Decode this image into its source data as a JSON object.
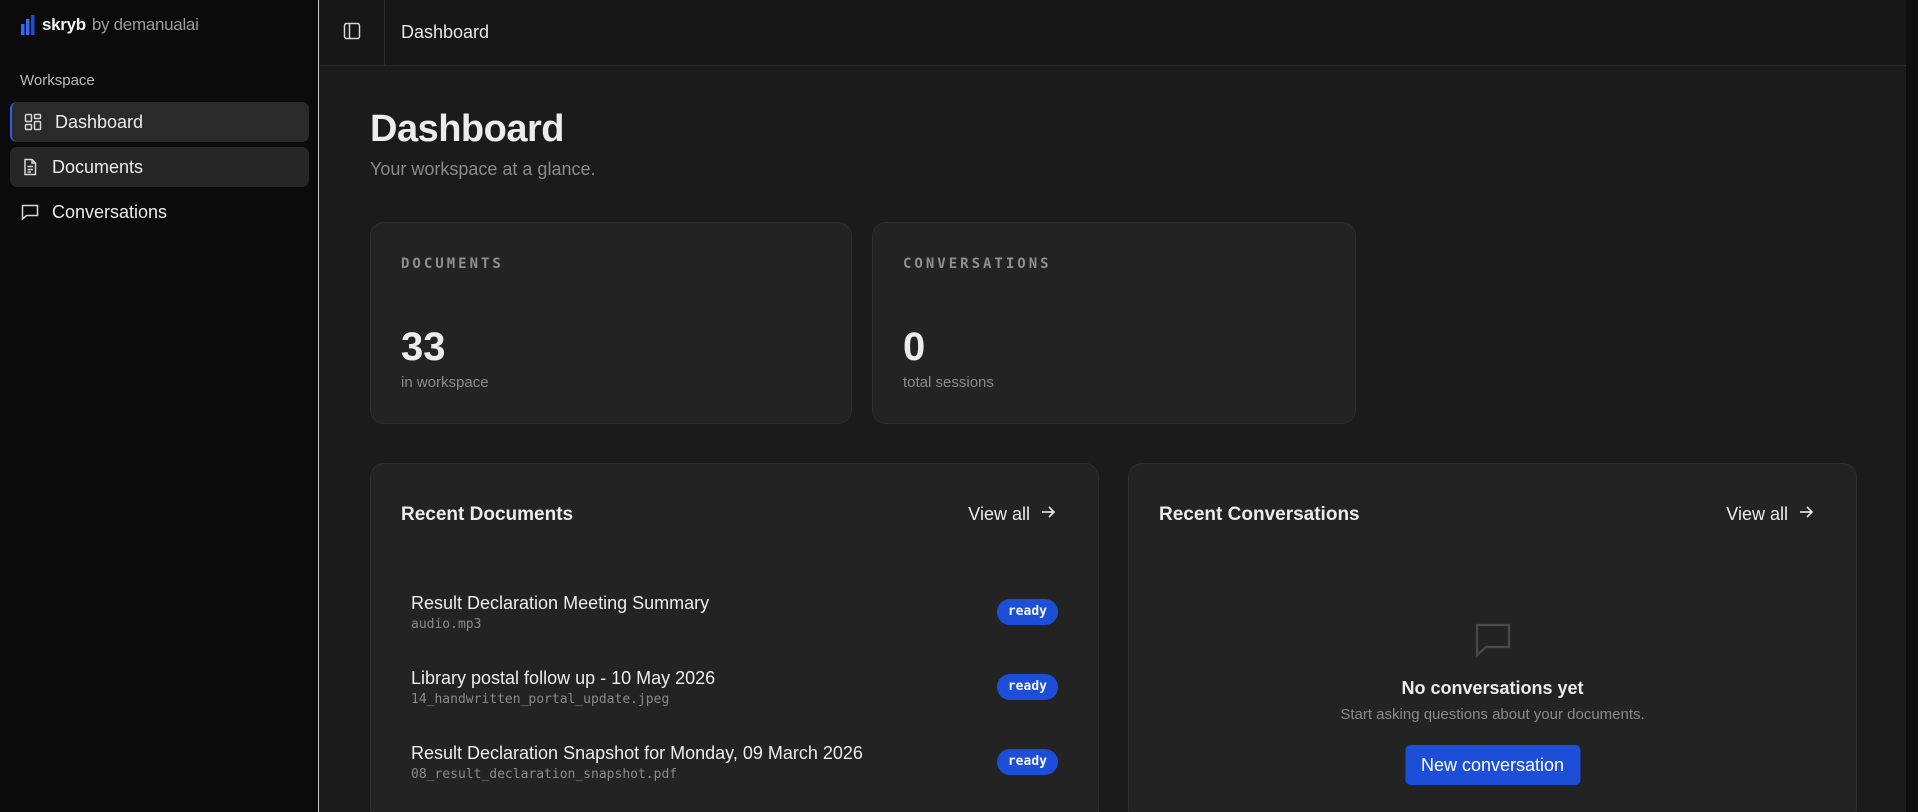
{
  "brand": {
    "name": "skryb",
    "by": "by demanualai"
  },
  "sidebar": {
    "section_label": "Workspace",
    "items": [
      {
        "label": "Dashboard",
        "icon": "dashboard-icon",
        "active": true
      },
      {
        "label": "Documents",
        "icon": "document-icon",
        "active": false
      },
      {
        "label": "Conversations",
        "icon": "chat-icon",
        "active": false
      }
    ]
  },
  "topbar": {
    "title": "Dashboard"
  },
  "page": {
    "title": "Dashboard",
    "subtitle": "Your workspace at a glance."
  },
  "stats": [
    {
      "label": "DOCUMENTS",
      "value": "33",
      "caption": "in workspace"
    },
    {
      "label": "CONVERSATIONS",
      "value": "0",
      "caption": "total sessions"
    }
  ],
  "recent_documents": {
    "title": "Recent Documents",
    "view_all": "View all",
    "items": [
      {
        "title": "Result Declaration Meeting Summary",
        "file": "audio.mp3",
        "status": "ready"
      },
      {
        "title": "Library postal follow up - 10 May 2026",
        "file": "14_handwritten_portal_update.jpeg",
        "status": "ready"
      },
      {
        "title": "Result Declaration Snapshot for Monday, 09 March 2026",
        "file": "08_result_declaration_snapshot.pdf",
        "status": "ready"
      }
    ]
  },
  "recent_conversations": {
    "title": "Recent Conversations",
    "view_all": "View all",
    "empty_title": "No conversations yet",
    "empty_subtitle": "Start asking questions about your documents.",
    "new_button": "New conversation"
  },
  "colors": {
    "accent": "#1d4ed8",
    "sidebar_bg": "#0b0b0b",
    "card_bg": "#232323"
  }
}
